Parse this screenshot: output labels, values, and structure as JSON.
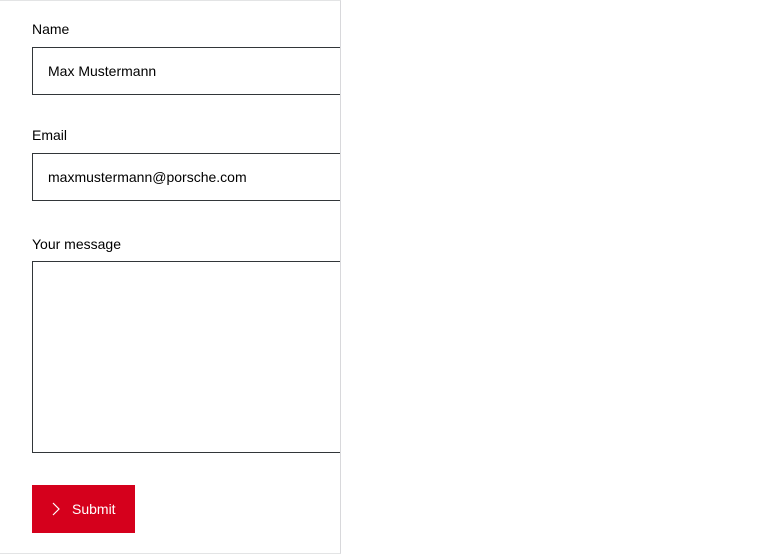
{
  "form": {
    "name": {
      "label": "Name",
      "value": "Max Mustermann"
    },
    "email": {
      "label": "Email",
      "value": "maxmustermann@porsche.com"
    },
    "message": {
      "label": "Your message",
      "value": ""
    },
    "submit": {
      "label": "Submit",
      "icon": "chevron-right-icon",
      "color": "#d5001c"
    }
  }
}
